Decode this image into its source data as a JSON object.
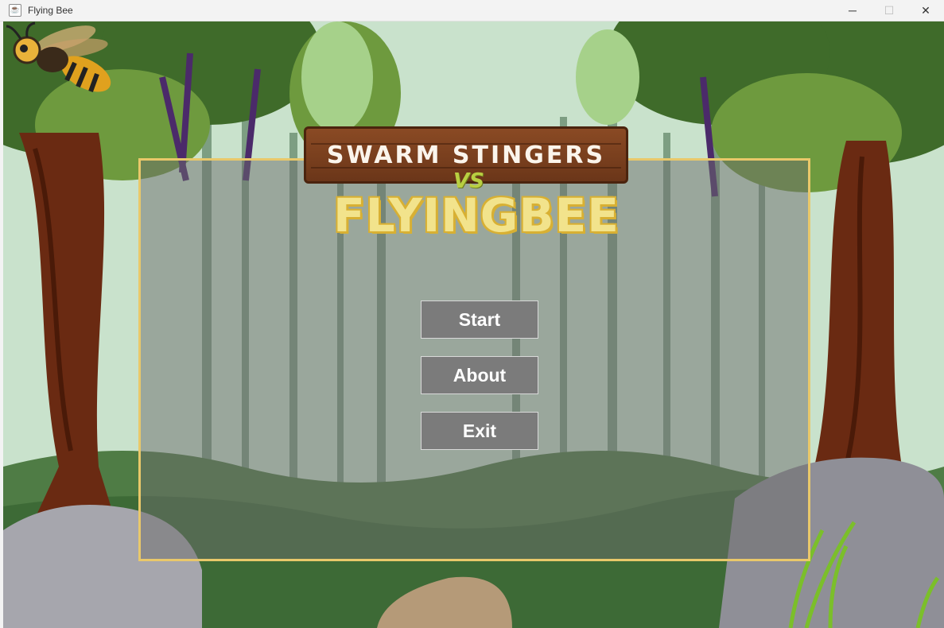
{
  "window": {
    "title": "Flying Bee",
    "controls": {
      "minimize": "─",
      "maximize": "☐",
      "close": "✕"
    }
  },
  "logo": {
    "top_text": "SWARM STINGERS",
    "vs_text": "VS",
    "main_text": "FLYINGBEE"
  },
  "menu": {
    "start_label": "Start",
    "about_label": "About",
    "exit_label": "Exit"
  },
  "colors": {
    "panel_border": "#e9c86a",
    "button_bg": "#7b7b7b",
    "button_text": "#ffffff",
    "title_yellow": "#f2e38c",
    "board_brown": "#7a3f1f"
  }
}
